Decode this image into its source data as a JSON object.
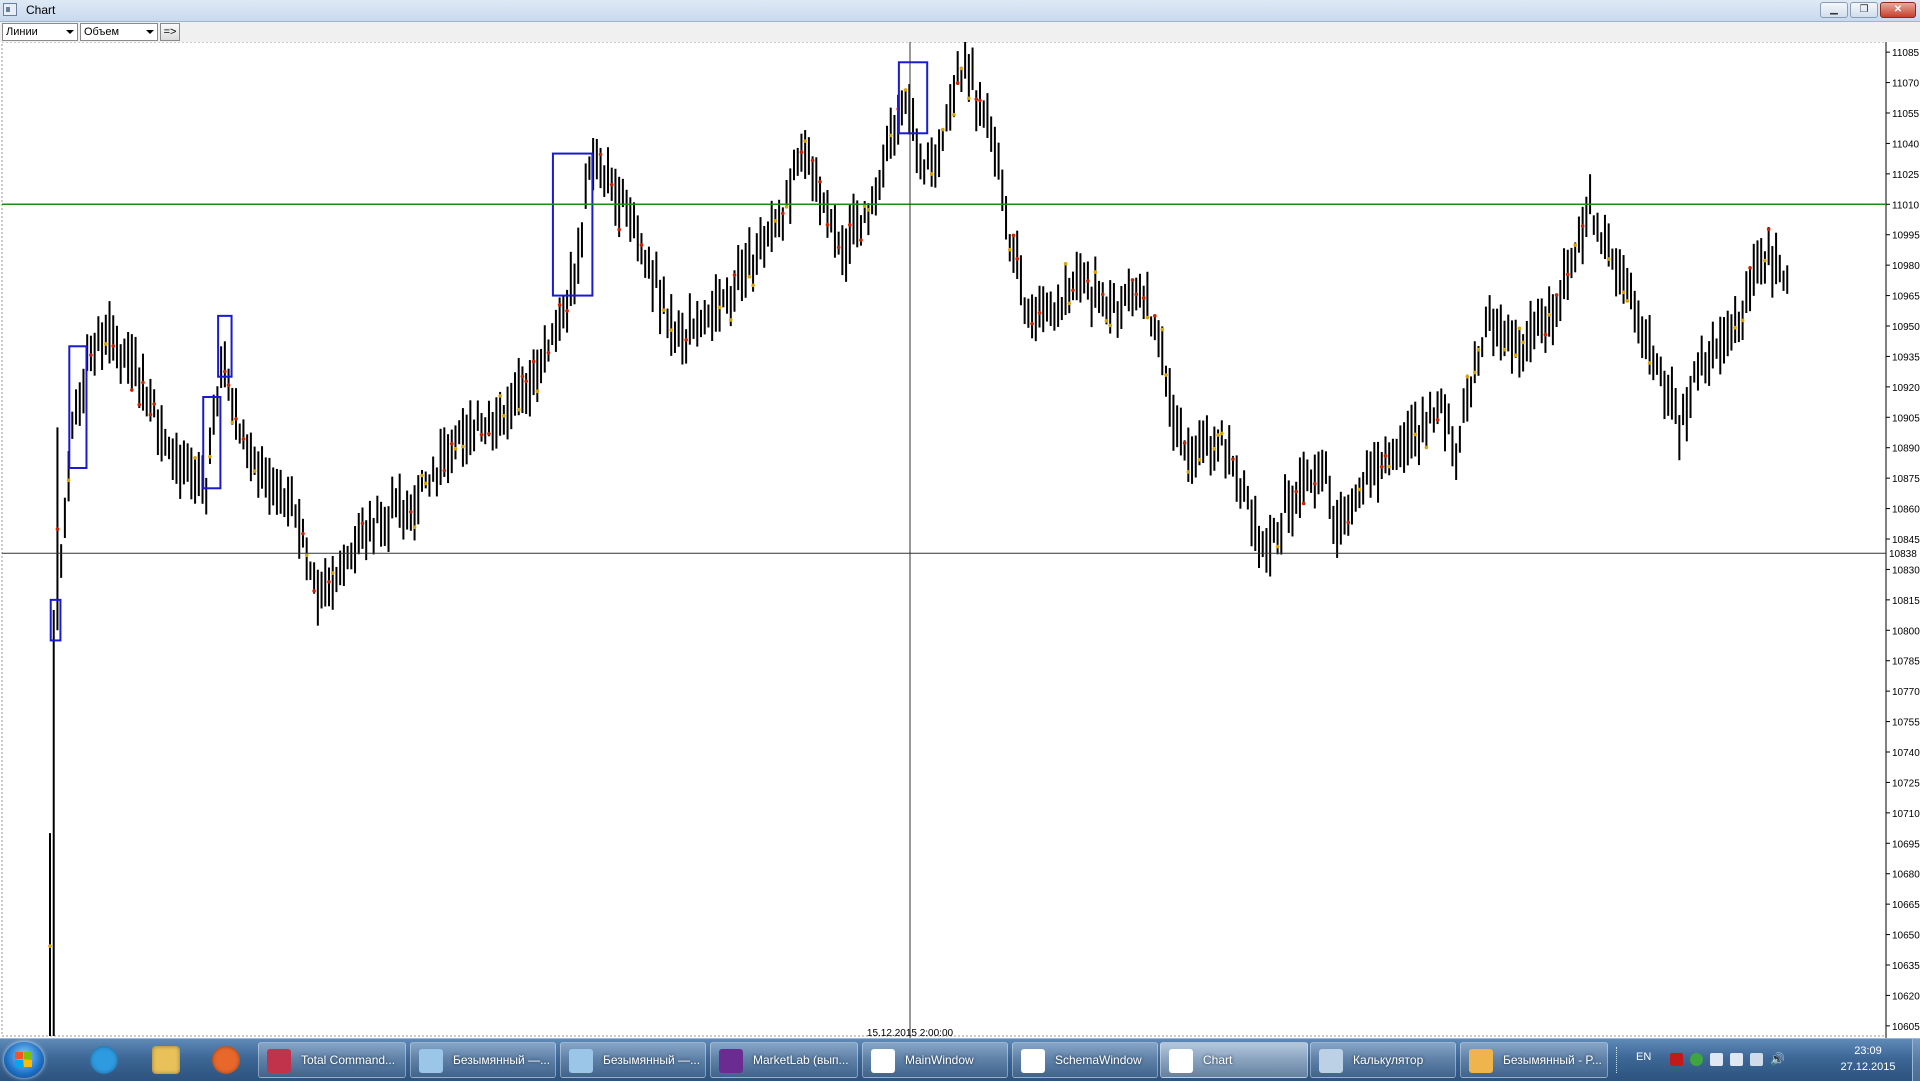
{
  "window": {
    "title": "Chart"
  },
  "toolbar": {
    "mode_combo": "Линии",
    "indicator_combo": "Объем",
    "go_button": "=>"
  },
  "chart_data": {
    "type": "bar",
    "subtype": "ohlc",
    "ylim": [
      10600,
      11090
    ],
    "y_ticks": [
      11085,
      11070,
      11055,
      11040,
      11025,
      11010,
      10995,
      10980,
      10965,
      10950,
      10935,
      10920,
      10905,
      10890,
      10875,
      10860,
      10845,
      10830,
      10815,
      10800,
      10785,
      10770,
      10755,
      10740,
      10725,
      10710,
      10695,
      10680,
      10665,
      10650,
      10635,
      10620,
      10605
    ],
    "y_tick_labels": [
      "11085",
      "11070",
      "11055",
      "11040",
      "11025",
      "11010",
      "10995",
      "10980",
      "10965",
      "10950",
      "10935",
      "10920",
      "10905",
      "10890",
      "10875",
      "10860",
      "10845",
      "10830",
      "10815",
      "10800",
      "10785",
      "10770",
      "10755",
      "10740",
      "10725",
      "10710",
      "10695",
      "10680",
      "10665",
      "10650",
      "10635",
      "10620",
      "10605"
    ],
    "hline_green": 11010,
    "crosshair": {
      "price": 10838,
      "price_label": "10838",
      "time_label": "15.12.2015 2:00:00"
    },
    "path_anchors": [
      [
        0,
        10600
      ],
      [
        3,
        10830
      ],
      [
        6,
        10900
      ],
      [
        10,
        10935
      ],
      [
        15,
        10945
      ],
      [
        22,
        10935
      ],
      [
        30,
        10900
      ],
      [
        36,
        10880
      ],
      [
        42,
        10870
      ],
      [
        46,
        10935
      ],
      [
        52,
        10890
      ],
      [
        58,
        10875
      ],
      [
        66,
        10860
      ],
      [
        72,
        10815
      ],
      [
        80,
        10840
      ],
      [
        88,
        10855
      ],
      [
        96,
        10860
      ],
      [
        104,
        10880
      ],
      [
        112,
        10895
      ],
      [
        120,
        10905
      ],
      [
        128,
        10920
      ],
      [
        134,
        10940
      ],
      [
        138,
        10955
      ],
      [
        142,
        10985
      ],
      [
        145,
        11030
      ],
      [
        150,
        11020
      ],
      [
        156,
        11005
      ],
      [
        162,
        10975
      ],
      [
        168,
        10945
      ],
      [
        174,
        10950
      ],
      [
        180,
        10960
      ],
      [
        186,
        10975
      ],
      [
        192,
        10990
      ],
      [
        198,
        11010
      ],
      [
        202,
        11035
      ],
      [
        206,
        11020
      ],
      [
        210,
        11000
      ],
      [
        214,
        10990
      ],
      [
        218,
        11000
      ],
      [
        222,
        11010
      ],
      [
        226,
        11040
      ],
      [
        230,
        11065
      ],
      [
        234,
        11030
      ],
      [
        238,
        11035
      ],
      [
        242,
        11060
      ],
      [
        246,
        11080
      ],
      [
        250,
        11060
      ],
      [
        254,
        11040
      ],
      [
        258,
        10995
      ],
      [
        262,
        10960
      ],
      [
        266,
        10955
      ],
      [
        270,
        10960
      ],
      [
        274,
        10965
      ],
      [
        278,
        10975
      ],
      [
        282,
        10960
      ],
      [
        286,
        10960
      ],
      [
        290,
        10965
      ],
      [
        294,
        10965
      ],
      [
        298,
        10940
      ],
      [
        302,
        10905
      ],
      [
        306,
        10885
      ],
      [
        310,
        10890
      ],
      [
        314,
        10895
      ],
      [
        318,
        10880
      ],
      [
        322,
        10860
      ],
      [
        326,
        10840
      ],
      [
        330,
        10850
      ],
      [
        334,
        10865
      ],
      [
        338,
        10875
      ],
      [
        342,
        10880
      ],
      [
        346,
        10850
      ],
      [
        350,
        10860
      ],
      [
        354,
        10875
      ],
      [
        358,
        10885
      ],
      [
        362,
        10890
      ],
      [
        366,
        10895
      ],
      [
        370,
        10905
      ],
      [
        374,
        10910
      ],
      [
        378,
        10890
      ],
      [
        382,
        10920
      ],
      [
        386,
        10950
      ],
      [
        390,
        10945
      ],
      [
        394,
        10940
      ],
      [
        398,
        10945
      ],
      [
        402,
        10950
      ],
      [
        406,
        10965
      ],
      [
        410,
        10990
      ],
      [
        414,
        11005
      ],
      [
        418,
        10990
      ],
      [
        422,
        10975
      ],
      [
        426,
        10960
      ],
      [
        430,
        10940
      ],
      [
        434,
        10920
      ],
      [
        438,
        10900
      ],
      [
        442,
        10925
      ],
      [
        446,
        10935
      ],
      [
        450,
        10945
      ],
      [
        454,
        10955
      ],
      [
        458,
        10975
      ],
      [
        462,
        10985
      ],
      [
        467,
        10975
      ]
    ],
    "highlight_boxes": [
      {
        "bar_from": 1,
        "bar_to": 2,
        "low": 10795,
        "high": 10815
      },
      {
        "bar_from": 6,
        "bar_to": 9,
        "low": 10880,
        "high": 10940
      },
      {
        "bar_from": 42,
        "bar_to": 45,
        "low": 10870,
        "high": 10915
      },
      {
        "bar_from": 46,
        "bar_to": 48,
        "low": 10925,
        "high": 10955
      },
      {
        "bar_from": 136,
        "bar_to": 145,
        "low": 10965,
        "high": 11035
      },
      {
        "bar_from": 229,
        "bar_to": 235,
        "low": 11045,
        "high": 11080
      }
    ]
  },
  "taskbar": {
    "pinned": [
      {
        "name": "internet-explorer-icon",
        "color": "#2e9ae0"
      },
      {
        "name": "file-explorer-icon",
        "color": "#e8c15a"
      },
      {
        "name": "firefox-icon",
        "color": "#e8682b"
      }
    ],
    "items": [
      {
        "label": "Total Command...",
        "icon": "save-disk-icon",
        "color": "#c0334a",
        "active": false
      },
      {
        "label": "Безымянный —...",
        "icon": "paint-icon",
        "color": "#9cc6e8",
        "active": false
      },
      {
        "label": "Безымянный —...",
        "icon": "paint-icon",
        "color": "#9cc6e8",
        "active": false
      },
      {
        "label": "MarketLab (вып...",
        "icon": "visual-studio-icon",
        "color": "#6a2c91",
        "active": false
      },
      {
        "label": "MainWindow",
        "icon": "window-app-icon",
        "color": "#ffffff",
        "active": false
      },
      {
        "label": "SchemaWindow",
        "icon": "window-app-icon",
        "color": "#ffffff",
        "active": false
      },
      {
        "label": "Chart",
        "icon": "window-app-icon",
        "color": "#ffffff",
        "active": true
      },
      {
        "label": "Калькулятор",
        "icon": "calculator-icon",
        "color": "#bcd0e6",
        "active": false
      },
      {
        "label": "Безымянный - P...",
        "icon": "paint-palette-icon",
        "color": "#f0b44c",
        "active": false
      }
    ],
    "language": "EN",
    "clock_time": "23:09",
    "clock_date": "27.12.2015"
  }
}
